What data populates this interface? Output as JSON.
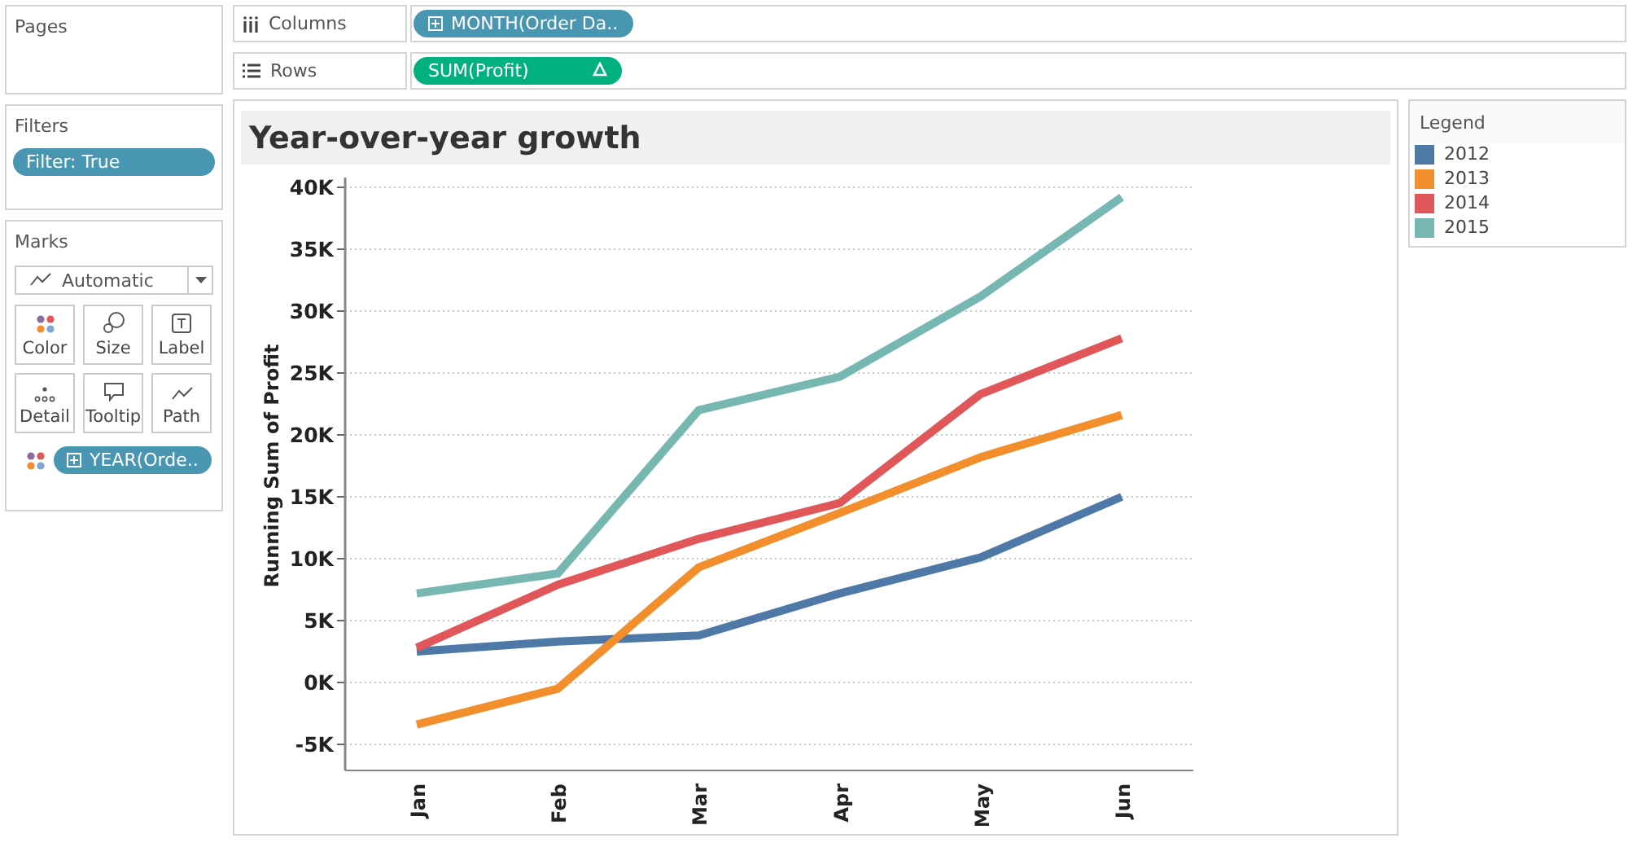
{
  "pages": {
    "title": "Pages"
  },
  "filters": {
    "title": "Filters",
    "pills": [
      "Filter: True"
    ]
  },
  "marks": {
    "title": "Marks",
    "mark_type": "Automatic",
    "buttons": [
      {
        "kind": "color",
        "label": "Color"
      },
      {
        "kind": "size",
        "label": "Size"
      },
      {
        "kind": "label",
        "label": "Label"
      },
      {
        "kind": "detail",
        "label": "Detail"
      },
      {
        "kind": "tooltip",
        "label": "Tooltip"
      },
      {
        "kind": "path",
        "label": "Path"
      }
    ],
    "fields": [
      {
        "kind": "color",
        "label": "YEAR(Orde.."
      }
    ]
  },
  "shelves": [
    {
      "kind": "columns",
      "label": "Columns",
      "pills": [
        {
          "label": "MONTH(Order Da..",
          "kind": "dimension",
          "delta": false
        }
      ]
    },
    {
      "kind": "rows",
      "label": "Rows",
      "pills": [
        {
          "label": "SUM(Profit)",
          "kind": "measure",
          "delta": true
        }
      ]
    }
  ],
  "view": {
    "title": "Year-over-year growth",
    "chart_data": {
      "type": "line",
      "grid": true,
      "ylabel": "Running Sum of Profit",
      "categories": [
        "Jan",
        "Feb",
        "Mar",
        "Apr",
        "May",
        "Jun"
      ],
      "ylim": [
        -5000,
        40000
      ],
      "yticks": [
        {
          "value": -5000,
          "label": "-5K"
        },
        {
          "value": 0,
          "label": "0K"
        },
        {
          "value": 5000,
          "label": "5K"
        },
        {
          "value": 10000,
          "label": "10K"
        },
        {
          "value": 15000,
          "label": "15K"
        },
        {
          "value": 20000,
          "label": "20K"
        },
        {
          "value": 25000,
          "label": "25K"
        },
        {
          "value": 30000,
          "label": "30K"
        },
        {
          "value": 35000,
          "label": "35K"
        },
        {
          "value": 40000,
          "label": "40K"
        }
      ],
      "series": [
        {
          "name": "2012",
          "color": "#4e79a7",
          "values": [
            2500,
            3300,
            3800,
            7200,
            10100,
            15000
          ]
        },
        {
          "name": "2013",
          "color": "#f28e2b",
          "values": [
            -3400,
            -500,
            9300,
            13700,
            18200,
            21600
          ]
        },
        {
          "name": "2014",
          "color": "#e15759",
          "values": [
            2800,
            7900,
            11600,
            14500,
            23300,
            27800
          ]
        },
        {
          "name": "2015",
          "color": "#76b7b2",
          "values": [
            7200,
            8800,
            22000,
            24700,
            31200,
            39200
          ]
        }
      ]
    }
  },
  "legend": {
    "title": "Legend"
  }
}
